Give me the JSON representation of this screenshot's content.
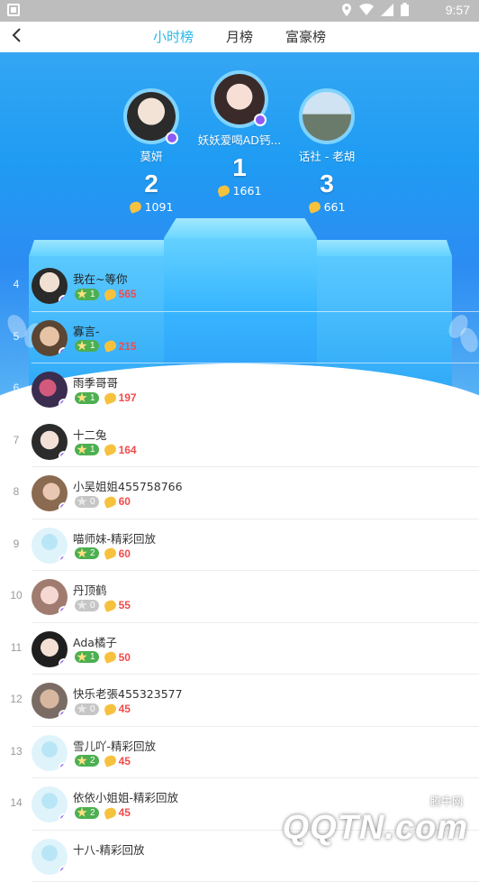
{
  "statusbar": {
    "time": "9:57"
  },
  "nav": {
    "back_icon": "chevron-left-icon",
    "tabs": [
      {
        "label": "小时榜"
      },
      {
        "label": "月榜"
      },
      {
        "label": "富豪榜"
      }
    ],
    "active_tab": 0
  },
  "podium": {
    "first": {
      "name": "妖妖爱喝AD钙...",
      "rank": "1",
      "score": "1661"
    },
    "second": {
      "name": "莫妍",
      "rank": "2",
      "score": "1091"
    },
    "third": {
      "name": "话社 - 老胡",
      "rank": "3",
      "score": "661"
    }
  },
  "list": [
    {
      "rank": "4",
      "name": "我在~等你",
      "level": "1",
      "score": "565"
    },
    {
      "rank": "5",
      "name": "寡言-",
      "level": "1",
      "score": "215"
    },
    {
      "rank": "6",
      "name": "雨季哥哥",
      "level": "1",
      "score": "197"
    },
    {
      "rank": "7",
      "name": "十二兔",
      "level": "1",
      "score": "164"
    },
    {
      "rank": "8",
      "name": "小吴姐姐455758766",
      "level": "0",
      "score": "60"
    },
    {
      "rank": "9",
      "name": "喵师妹-精彩回放",
      "level": "2",
      "score": "60"
    },
    {
      "rank": "10",
      "name": "丹顶鹤",
      "level": "0",
      "score": "55"
    },
    {
      "rank": "11",
      "name": "Ada橘子",
      "level": "1",
      "score": "50"
    },
    {
      "rank": "12",
      "name": "快乐老張455323577",
      "level": "0",
      "score": "45"
    },
    {
      "rank": "13",
      "name": "雪儿吖-精彩回放",
      "level": "2",
      "score": "45"
    },
    {
      "rank": "14",
      "name": "依依小姐姐-精彩回放",
      "level": "2",
      "score": "45"
    },
    {
      "rank": "",
      "name": "十八-精彩回放",
      "level": "",
      "score": ""
    }
  ],
  "watermark": {
    "top": "腾牛网",
    "main": "QQTN.com"
  },
  "colors": {
    "accent": "#28b7e8",
    "score_red": "#f24b4b",
    "level_green": "#4caf50",
    "level_grey": "#c6c6c6",
    "live_purple": "#8b5cf6"
  }
}
